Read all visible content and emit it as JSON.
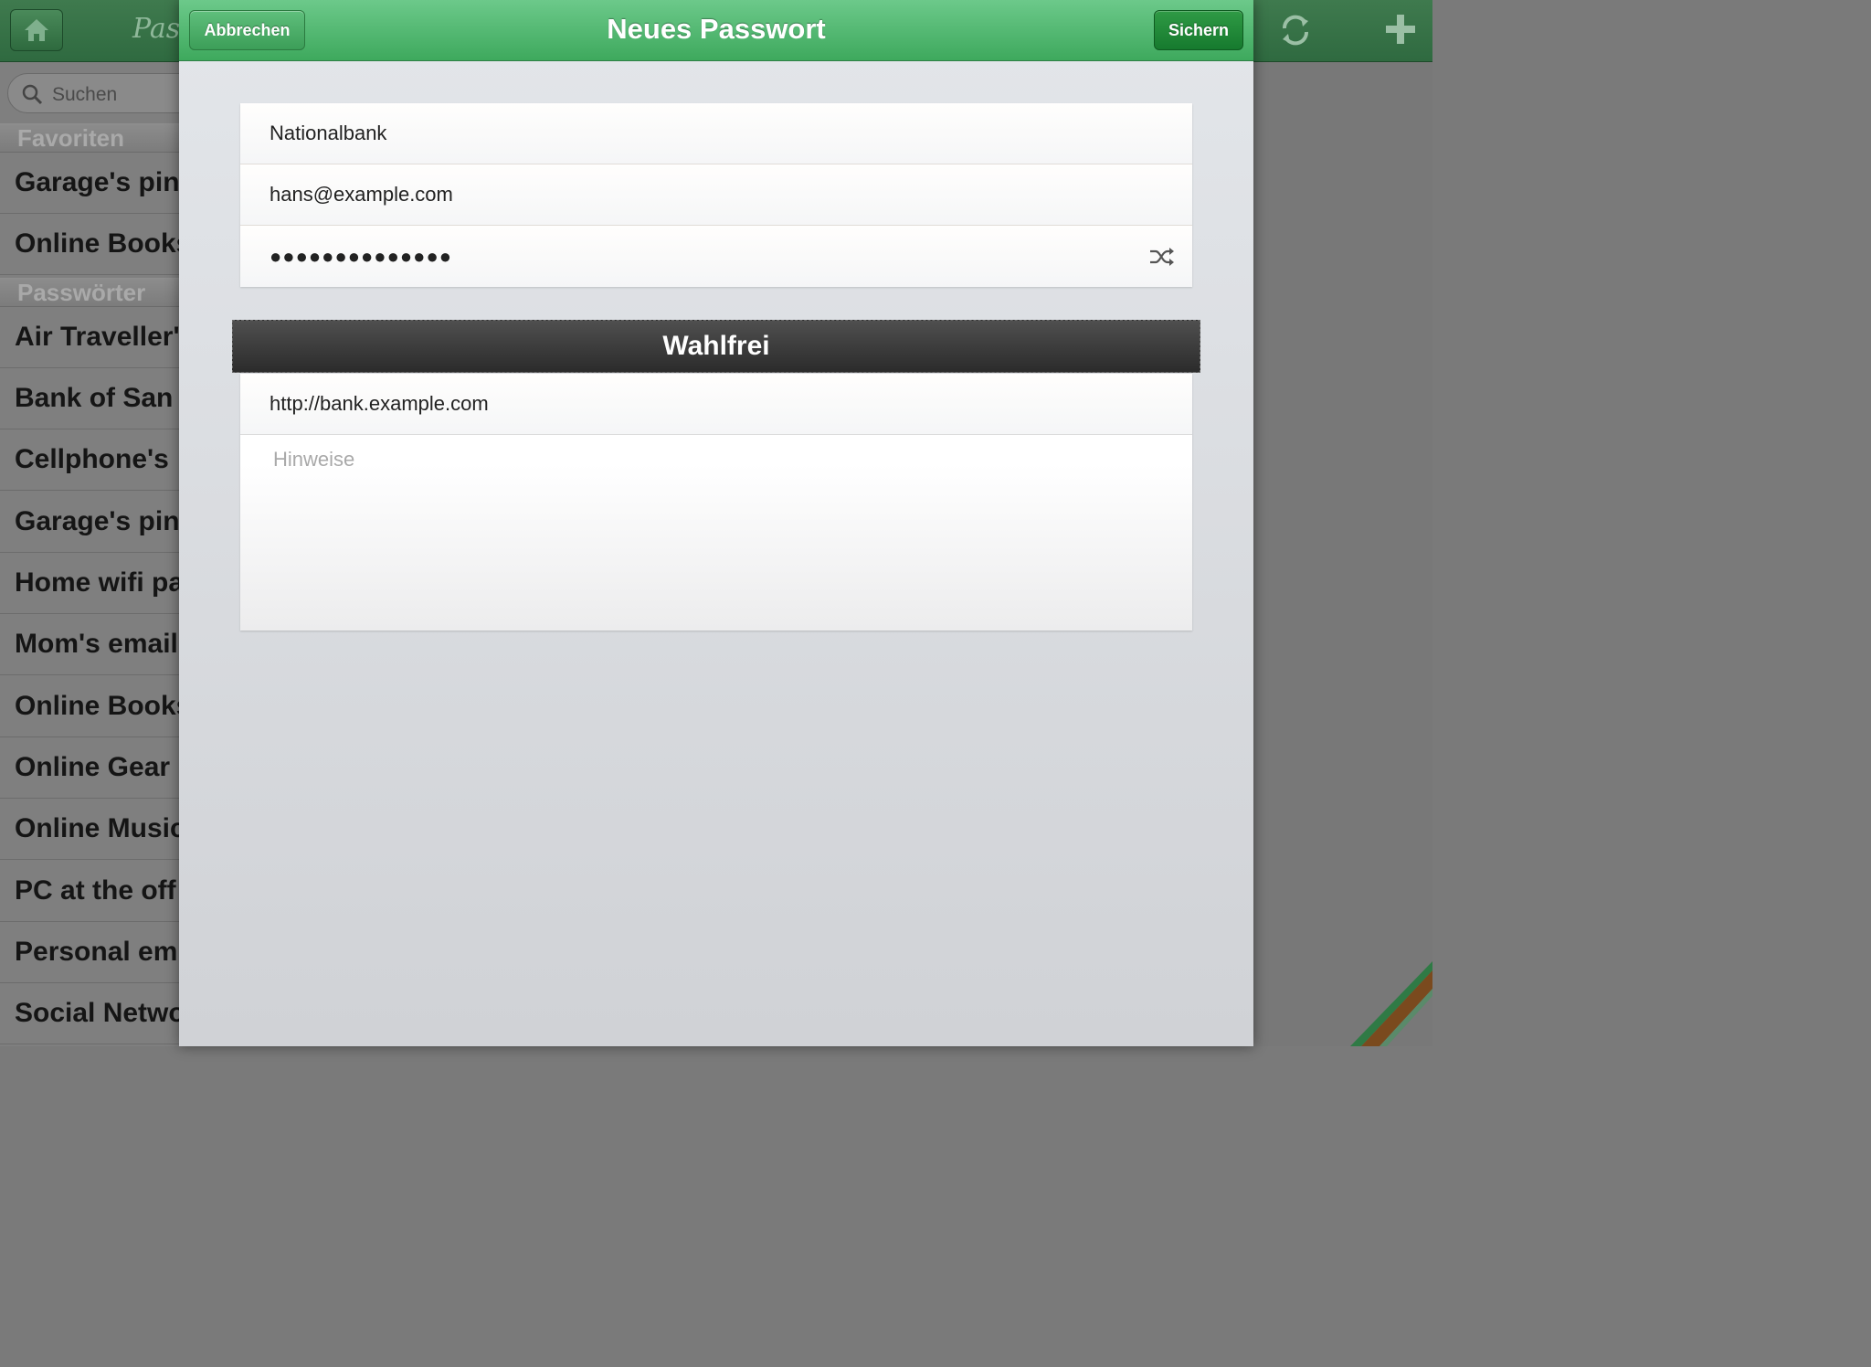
{
  "background_app": {
    "logo_text": "Pass",
    "search_placeholder": "Suchen",
    "sections": {
      "favorites": "Favoriten",
      "passwords": "Passwörter"
    },
    "favorites": [
      "Garage's pin",
      "Online Books"
    ],
    "passwords": [
      "Air Traveller's",
      "Bank of San",
      "Cellphone's",
      "Garage's pin",
      "Home wifi pa",
      "Mom's email",
      "Online Books",
      "Online Gear",
      "Online Music",
      "PC at the off",
      "Personal em",
      "Social Netwo"
    ]
  },
  "modal": {
    "title": "Neues Passwort",
    "cancel_label": "Abbrechen",
    "save_label": "Sichern",
    "fields": {
      "name": "Nationalbank",
      "username": "hans@example.com",
      "password_masked": "●●●●●●●●●●●●●●"
    },
    "optional_section_title": "Wahlfrei",
    "optional": {
      "url": "http://bank.example.com",
      "notes_placeholder": "Hinweise"
    }
  },
  "colors": {
    "modal_bar": "#4cb76a",
    "save_button": "#1f8a37",
    "section_header": "#3a3a3a"
  }
}
